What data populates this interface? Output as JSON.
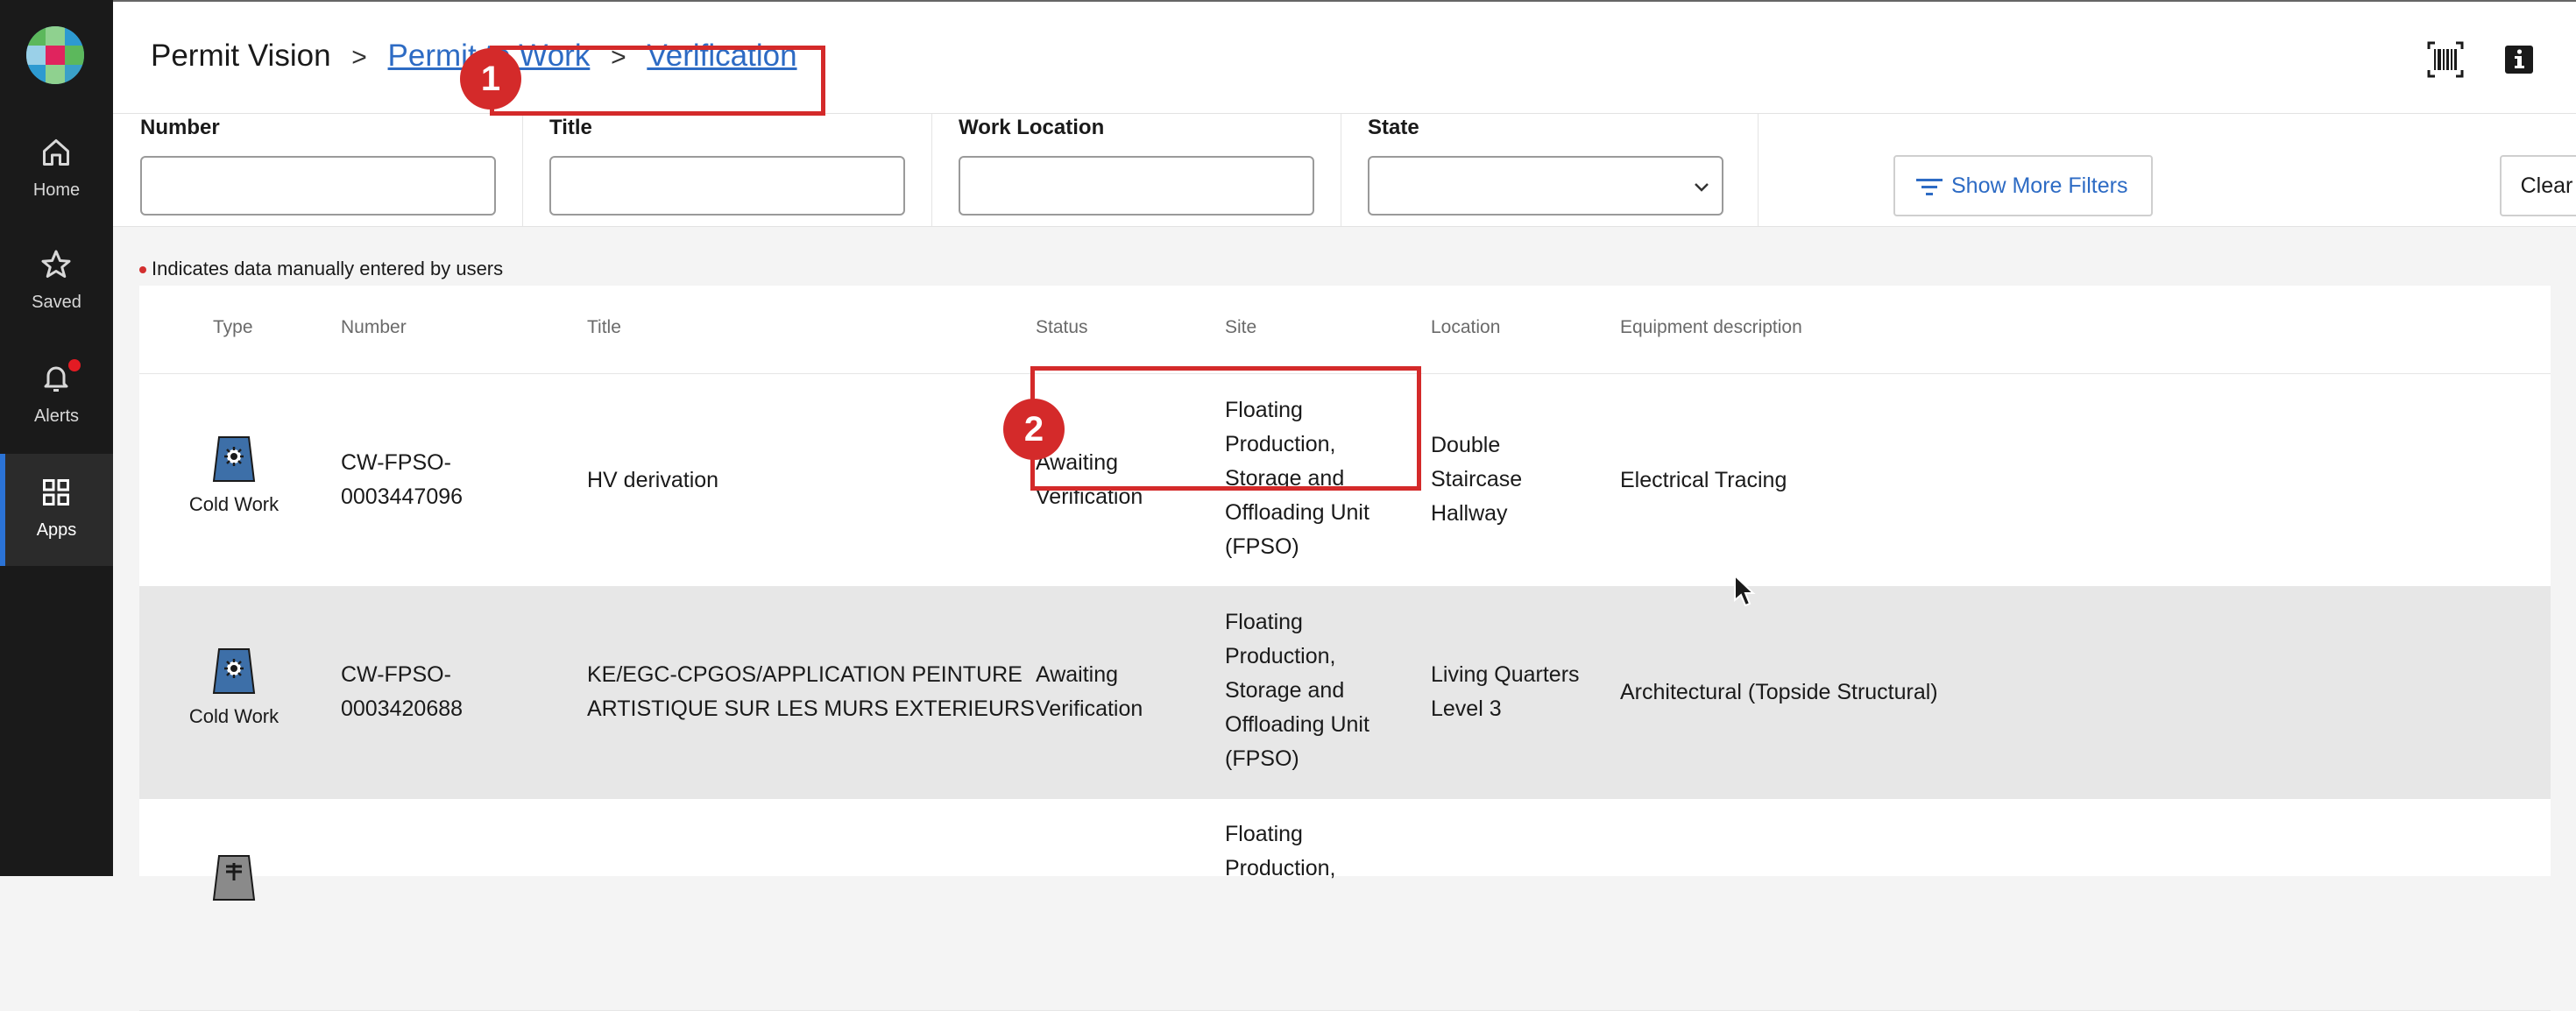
{
  "nav": {
    "items": [
      {
        "label": "Home",
        "icon": "home-icon"
      },
      {
        "label": "Saved",
        "icon": "star-icon"
      },
      {
        "label": "Alerts",
        "icon": "bell-icon"
      },
      {
        "label": "Apps",
        "icon": "grid-icon"
      }
    ],
    "active": "Apps"
  },
  "header": {
    "app_name": "Permit Vision",
    "breadcrumbs": [
      "Permit to Work",
      "Verification"
    ],
    "separator": ">"
  },
  "filters": {
    "number_label": "Number",
    "title_label": "Title",
    "work_location_label": "Work Location",
    "state_label": "State",
    "show_more_label": "Show More Filters",
    "clear_label": "Clear search"
  },
  "note": "Indicates data manually entered by users",
  "table": {
    "columns": [
      "Type",
      "Number",
      "Title",
      "Status",
      "Site",
      "Location",
      "Equipment description"
    ],
    "rows": [
      {
        "type": "Cold Work",
        "number_l1": "CW-FPSO-",
        "number_l2": "0003447096",
        "title_l1": "HV derivation",
        "title_l2": "",
        "status_l1": "Awaiting",
        "status_l2": "Verification",
        "site": [
          "Floating",
          "Production,",
          "Storage and",
          "Offloading Unit",
          "(FPSO)"
        ],
        "location": [
          "Double",
          "Staircase",
          "Hallway"
        ],
        "equipment": "Electrical Tracing"
      },
      {
        "type": "Cold Work",
        "number_l1": "CW-FPSO-",
        "number_l2": "0003420688",
        "title_l1": "KE/EGC-CPGOS/APPLICATION PEINTURE",
        "title_l2": "ARTISTIQUE SUR LES MURS EXTERIEURS",
        "status_l1": "Awaiting",
        "status_l2": "Verification",
        "site": [
          "Floating",
          "Production,",
          "Storage and",
          "Offloading Unit",
          "(FPSO)"
        ],
        "location": [
          "Living Quarters",
          "Level 3"
        ],
        "equipment": "Architectural (Topside Structural)"
      },
      {
        "type": "",
        "site": [
          "Floating",
          "Production,"
        ]
      }
    ]
  },
  "annotations": [
    "1",
    "2"
  ],
  "colors": {
    "accent": "#2d6bc4",
    "annotation": "#d42a2a",
    "rail": "#1a1a1a",
    "cold_work_icon": "#3d6fa8"
  }
}
